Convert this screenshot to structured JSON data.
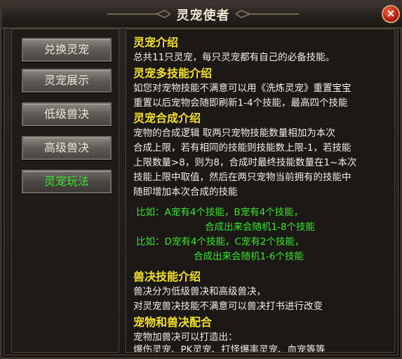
{
  "window": {
    "title": "灵宠使者",
    "close_label": "×"
  },
  "sidebar": {
    "items": [
      {
        "label": "兑换灵宠"
      },
      {
        "label": "灵宠展示"
      },
      {
        "label": "低级兽决"
      },
      {
        "label": "高级兽决"
      },
      {
        "label": "灵宠玩法"
      }
    ],
    "active_index": 4
  },
  "content": {
    "sections": [
      {
        "heading": "灵宠介绍",
        "lines": [
          "总共11只灵宠，每只灵宠都有自己的必备技能。"
        ]
      },
      {
        "heading": "灵宠多技能介绍",
        "lines": [
          "如您对宠物技能不满意可以用《洗炼灵宠》重置宝宝",
          "重置以后宠物会随即刷新1-4个技能，最高四个技能"
        ]
      },
      {
        "heading": "灵宠合成介绍",
        "lines": [
          "宠物的合成逻辑   取两只宠物技能数量相加为本次",
          "合成上限，若有相同的技能则技能数上限-1，若技能",
          "上限数量>8，则为8，合成时最终技能数量在1~本次",
          "技能上限中取值，然后在两只宠物当前拥有的技能中",
          "随即增加本次合成的技能"
        ],
        "examples": [
          "比如：A宠有4个技能，B宠有4个技能，",
          "合成出来会随机1-8个技能",
          "比如：D宠有4个技能，C宠有2个技能，",
          "合成出来会随机1-6个技能"
        ]
      },
      {
        "heading": "兽决技能介绍",
        "lines": [
          "兽决分为低级兽决和高级兽决，",
          "对灵宠兽决技能不满意可以兽决打书进行改变"
        ]
      },
      {
        "heading": "宠物和兽决配合",
        "lines": [
          "宠物加兽决可以打造出：",
          "爆伤灵宠、PK灵宠、打怪爆率灵宠、血宠等等"
        ]
      }
    ]
  },
  "colors": {
    "heading": "#f5e02a",
    "body_text": "#f2efe8",
    "example_text": "#39e62b",
    "active_tab": "#39e62b"
  }
}
